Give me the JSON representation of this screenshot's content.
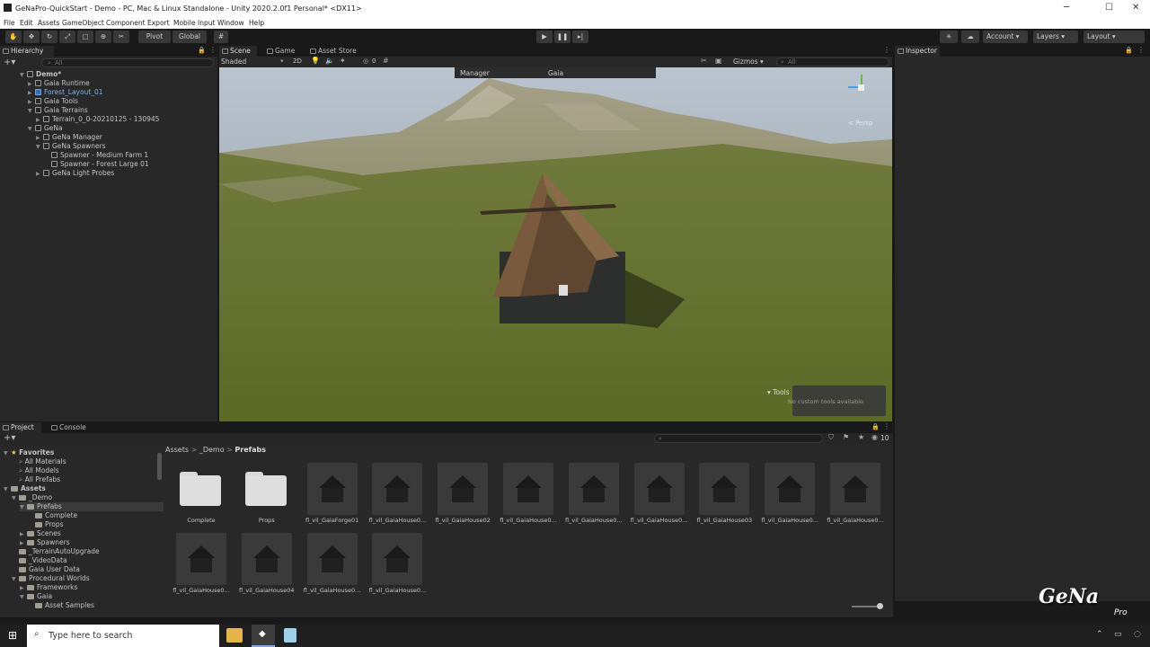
{
  "window": {
    "title": "GeNaPro-QuickStart - Demo - PC, Mac & Linux Standalone - Unity 2020.2.0f1 Personal* <DX11>",
    "controls": {
      "minimize": "─",
      "maximize": "☐",
      "close": "✕"
    }
  },
  "menu": [
    "File",
    "Edit",
    "Assets",
    "GameObject",
    "Component",
    "Export",
    "Mobile Input",
    "Window",
    "Help"
  ],
  "toolbar": {
    "pivot": "Pivot",
    "global": "Global",
    "account": "Account",
    "layers": "Layers",
    "layout": "Layout"
  },
  "hierarchy": {
    "tab": "Hierarchy",
    "search_placeholder": "All",
    "items": [
      {
        "label": "Demo*",
        "depth": 0,
        "bold": true
      },
      {
        "label": "Gaia Runtime",
        "depth": 1
      },
      {
        "label": "Forest_Layout_01",
        "depth": 1,
        "prefab": true
      },
      {
        "label": "Gaia Tools",
        "depth": 1
      },
      {
        "label": "Gaia Terrains",
        "depth": 1
      },
      {
        "label": "Terrain_0_0-20210125 - 130945",
        "depth": 2
      },
      {
        "label": "GeNa",
        "depth": 1
      },
      {
        "label": "GeNa Manager",
        "depth": 2
      },
      {
        "label": "GeNa Spawners",
        "depth": 2
      },
      {
        "label": "Spawner - Medium Farm 1",
        "depth": 3
      },
      {
        "label": "Spawner - Forest Large 01",
        "depth": 3
      },
      {
        "label": "GeNa Light Probes",
        "depth": 2
      }
    ]
  },
  "scene": {
    "tabs": [
      "Scene",
      "Game",
      "Asset Store"
    ],
    "shading": "Shaded",
    "mode_2d": "2D",
    "hidden_count": "0",
    "gizmos": "Gizmos",
    "search_placeholder": "All",
    "overlay_tabs": [
      "Manager",
      "Gaia"
    ],
    "persp": "< Persp",
    "tools_title": "Tools",
    "tools_text": "No custom tools available"
  },
  "inspector": {
    "tab": "Inspector"
  },
  "project": {
    "tabs": [
      "Project",
      "Console"
    ],
    "visible_count": "10",
    "breadcrumb": [
      "Assets",
      "_Demo",
      "Prefabs"
    ],
    "tree": [
      {
        "label": "Favorites",
        "depth": 0,
        "bold": true
      },
      {
        "label": "All Materials",
        "depth": 1
      },
      {
        "label": "All Models",
        "depth": 1
      },
      {
        "label": "All Prefabs",
        "depth": 1
      },
      {
        "label": "Assets",
        "depth": 0,
        "bold": true
      },
      {
        "label": "_Demo",
        "depth": 1
      },
      {
        "label": "Prefabs",
        "depth": 2,
        "selected": true
      },
      {
        "label": "Complete",
        "depth": 3
      },
      {
        "label": "Props",
        "depth": 3
      },
      {
        "label": "Scenes",
        "depth": 2
      },
      {
        "label": "Spawners",
        "depth": 2
      },
      {
        "label": "_TerrainAutoUpgrade",
        "depth": 1
      },
      {
        "label": "_VideoData",
        "depth": 1
      },
      {
        "label": "Gaia User Data",
        "depth": 1
      },
      {
        "label": "Procedural Worlds",
        "depth": 1
      },
      {
        "label": "Frameworks",
        "depth": 2
      },
      {
        "label": "Gaia",
        "depth": 2
      },
      {
        "label": "Asset Samples",
        "depth": 3
      }
    ],
    "assets": [
      {
        "label": "Complete",
        "type": "folder"
      },
      {
        "label": "Props",
        "type": "folder"
      },
      {
        "label": "fl_vil_GaiaForge01",
        "type": "prefab"
      },
      {
        "label": "fl_vil_GaiaHouse0...",
        "type": "prefab"
      },
      {
        "label": "fl_vil_GaiaHouse02",
        "type": "prefab"
      },
      {
        "label": "fl_vil_GaiaHouse0...",
        "type": "prefab"
      },
      {
        "label": "fl_vil_GaiaHouse0...",
        "type": "prefab"
      },
      {
        "label": "fl_vil_GaiaHouse0...",
        "type": "prefab"
      },
      {
        "label": "fl_vil_GaiaHouse03",
        "type": "prefab"
      },
      {
        "label": "fl_vil_GaiaHouse0...",
        "type": "prefab"
      },
      {
        "label": "fl_vil_GaiaHouse0...",
        "type": "prefab"
      },
      {
        "label": "fl_vil_GaiaHouse0...",
        "type": "prefab"
      },
      {
        "label": "fl_vil_GaiaHouse04",
        "type": "prefab"
      },
      {
        "label": "fl_vil_GaiaHouse0...",
        "type": "prefab"
      },
      {
        "label": "fl_vil_GaiaHouse0...",
        "type": "prefab"
      }
    ]
  },
  "taskbar": {
    "search_placeholder": "Type here to search"
  },
  "watermark": {
    "logo": "GeNa",
    "sub": "Pro"
  }
}
